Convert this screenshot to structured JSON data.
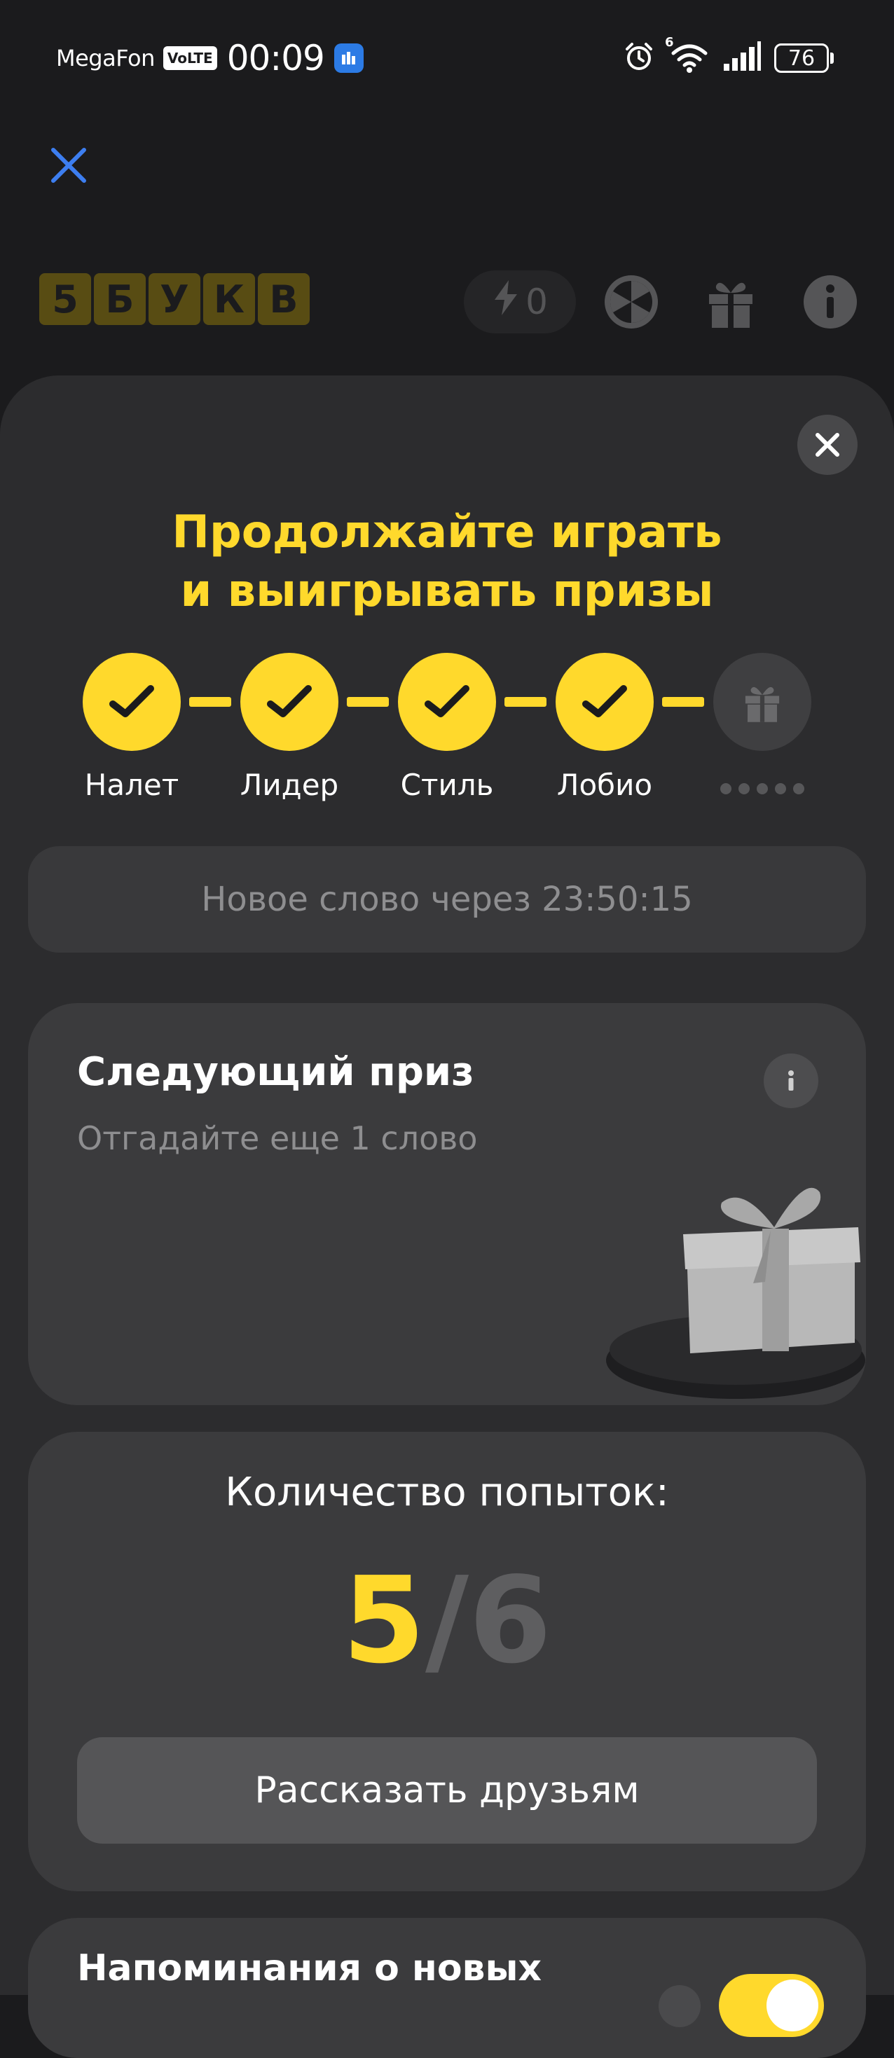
{
  "status_bar": {
    "carrier": "MegaFon",
    "volte": "VoLTE",
    "time": "00:09",
    "battery": "76",
    "wifi_badge": "6",
    "icons": [
      "alarm-icon",
      "wifi-icon",
      "signal-icon",
      "battery-icon"
    ]
  },
  "header": {
    "logo_letters": [
      "5",
      "Б",
      "У",
      "К",
      "В"
    ],
    "energy_count": "0",
    "icons": [
      "lightning-icon",
      "wheel-icon",
      "gift-icon",
      "info-icon"
    ]
  },
  "sheet": {
    "title_line1": "Продолжайте играть",
    "title_line2": "и выигрывать призы",
    "steps": [
      {
        "label": "Налет",
        "done": true
      },
      {
        "label": "Лидер",
        "done": true
      },
      {
        "label": "Стиль",
        "done": true
      },
      {
        "label": "Лобио",
        "done": true
      }
    ],
    "timer_text": "Новое слово через 23:50:15",
    "prize": {
      "title": "Следующий приз",
      "subtitle": "Отгадайте еще 1 слово"
    },
    "attempts": {
      "label": "Количество попыток:",
      "used": "5",
      "separator": "/",
      "total": "6",
      "share_label": "Рассказать друзьям"
    },
    "reminder": {
      "label": "Напоминания о новых",
      "enabled": true
    }
  },
  "colors": {
    "accent": "#ffd92c",
    "background": "#1b1b1d",
    "sheet": "#2c2c2e",
    "card": "#3b3b3d",
    "close_blue": "#3d7ef0"
  }
}
